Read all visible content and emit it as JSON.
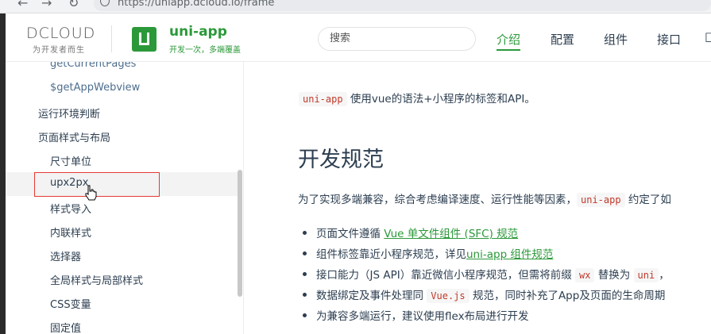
{
  "browser": {
    "url": "https://uniapp.dcloud.io/frame"
  },
  "header": {
    "dcloud_logo": "DCLOUD",
    "dcloud_slogan": "为开发者而生",
    "brand_name": "uni-app",
    "brand_slogan": "开发一次，多端覆盖",
    "search_placeholder": "搜索",
    "nav": [
      "介绍",
      "配置",
      "组件",
      "接口"
    ],
    "active_nav": "介绍",
    "nav_cut": "□"
  },
  "sidebar": {
    "items": [
      {
        "label": "getCurrentPages",
        "level": 3
      },
      {
        "label": "$getAppWebview",
        "level": 3
      },
      {
        "label": "运行环境判断",
        "level": 1
      },
      {
        "label": "页面样式与布局",
        "level": 1
      },
      {
        "label": "尺寸单位",
        "level": 2
      },
      {
        "label": "upx2px",
        "level": 2,
        "highlighted": true
      },
      {
        "label": "样式导入",
        "level": 2
      },
      {
        "label": "内联样式",
        "level": 2
      },
      {
        "label": "选择器",
        "level": 2
      },
      {
        "label": "全局样式与局部样式",
        "level": 2
      },
      {
        "label": "CSS变量",
        "level": 2
      },
      {
        "label": "固定值",
        "level": 2
      }
    ]
  },
  "content": {
    "intro_code": "uni-app",
    "intro_text": " 使用vue的语法+小程序的标签和API。",
    "section_title": "开发规范",
    "para_text": "为了实现多端兼容，综合考虑编译速度、运行性能等因素，",
    "para_code": "uni-app",
    "para_tail": " 约定了如",
    "bullets": {
      "b1_text": "页面文件遵循 ",
      "b1_link": "Vue 单文件组件 (SFC) 规范",
      "b2_text": "组件标签靠近小程序规范，详见",
      "b2_link": "uni-app 组件规范",
      "b3_text": "接口能力（JS API）靠近微信小程序规范，但需将前缀 ",
      "b3_code1": "wx",
      "b3_mid": " 替换为 ",
      "b3_code2": "uni",
      "b3_tail": "，",
      "b4_text": "数据绑定及事件处理同 ",
      "b4_code": "Vue.js",
      "b4_tail": " 规范，同时补充了App及页面的生命周期",
      "b5_text": "为兼容多端运行，建议使用flex布局进行开发"
    }
  },
  "colors": {
    "brand_green": "#2b9939",
    "highlight_red": "#e53935",
    "code_red": "#c0392b"
  }
}
